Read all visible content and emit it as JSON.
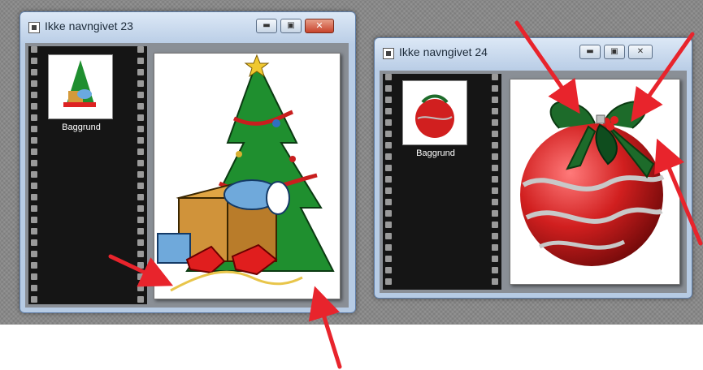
{
  "windows": [
    {
      "title": "Ikke navngivet 23",
      "layer_label": "Baggrund",
      "icon": "document-icon",
      "buttons": [
        "minimize-icon",
        "maximize-icon",
        "close-icon"
      ]
    },
    {
      "title": "Ikke navngivet 24",
      "layer_label": "Baggrund",
      "icon": "document-icon",
      "buttons": [
        "minimize-icon",
        "maximize-icon",
        "close-icon"
      ]
    }
  ],
  "colors": {
    "arrow": "#e8242c",
    "tree": "#1f8f2f",
    "ornament": "#d11f1f",
    "ribbon": "#1d6b2a"
  }
}
